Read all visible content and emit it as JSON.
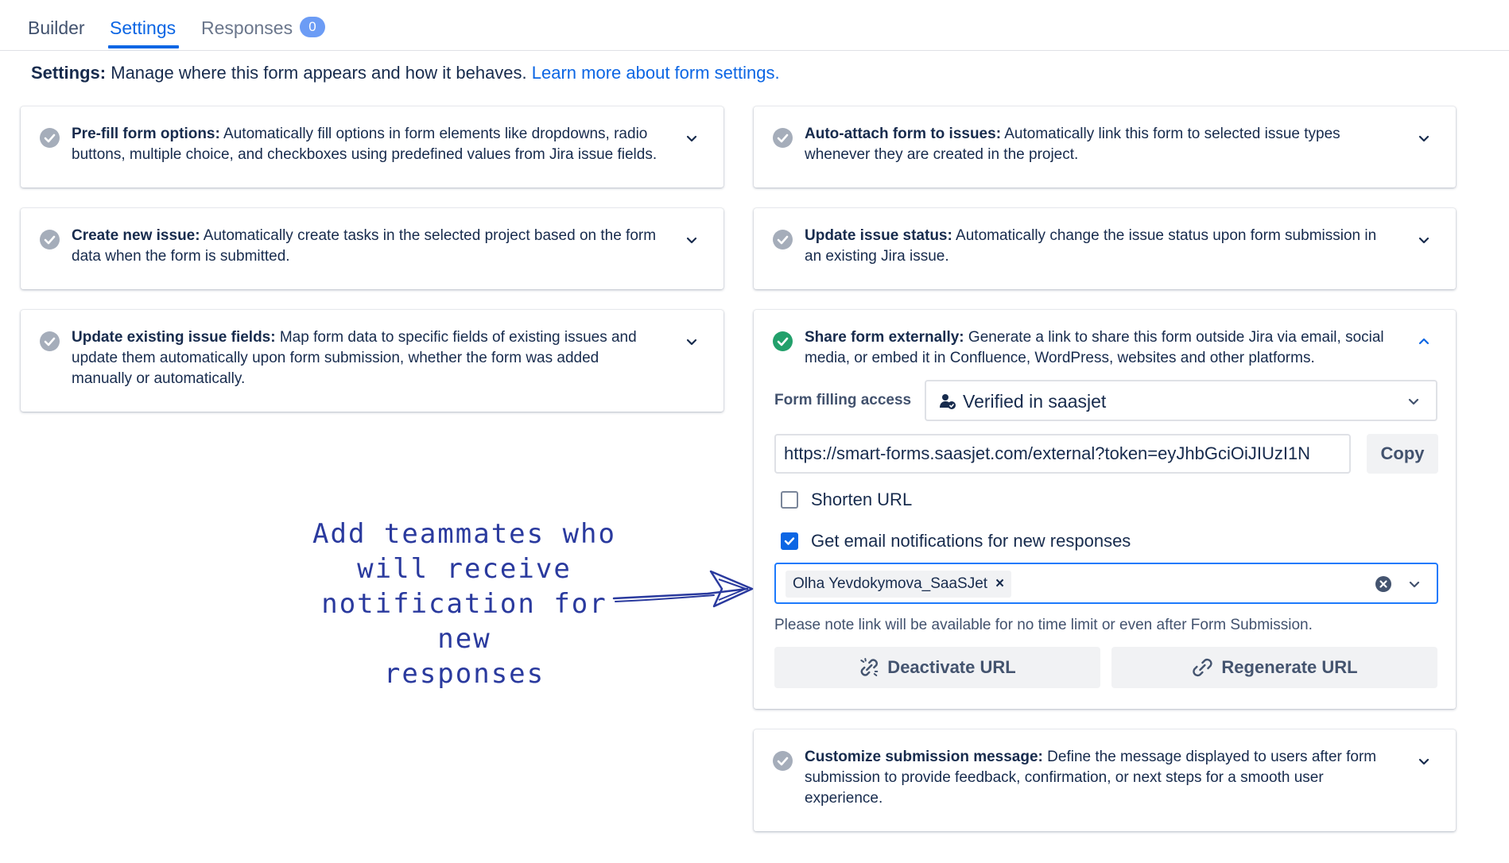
{
  "tabs": {
    "builder": "Builder",
    "settings": "Settings",
    "responses": "Responses",
    "responses_count": "0"
  },
  "intro": {
    "bold": "Settings:",
    "text": " Manage where this form appears and how it behaves. ",
    "link": "Learn more about form settings."
  },
  "cards": {
    "prefill": {
      "title": "Pre-fill form options:",
      "desc": " Automatically fill options in form elements like dropdowns, radio buttons, multiple choice, and checkboxes using predefined values from Jira issue fields."
    },
    "create_issue": {
      "title": "Create new issue:",
      "desc": " Automatically create tasks in the selected project based on the form data when the form is submitted."
    },
    "update_fields": {
      "title": "Update existing issue fields:",
      "desc": " Map form data to specific fields of existing issues and update them automatically upon form submission, whether the form was added manually or automatically."
    },
    "auto_attach": {
      "title": "Auto-attach form to issues:",
      "desc": " Automatically link this form to selected issue types whenever they are created in the project."
    },
    "update_status": {
      "title": "Update issue status:",
      "desc": " Automatically change the issue status upon form submission in an existing Jira issue."
    },
    "share": {
      "title": "Share form externally:",
      "desc": " Generate a link to share this form outside Jira via email, social media, or embed it in Confluence, WordPress, websites and other platforms.",
      "access_label": "Form filling access",
      "access_value": "Verified in saasjet",
      "url": "https://smart-forms.saasjet.com/external?token=eyJhbGciOiJIUzI1N",
      "copy_label": "Copy",
      "shorten_label": "Shorten URL",
      "shorten_checked": false,
      "notify_label": "Get email notifications for new responses",
      "notify_checked": true,
      "recipient": "Olha Yevdokymova_SaaSJet",
      "note": "Please note link will be available for no time limit or even after Form Submission.",
      "deactivate_label": "Deactivate URL",
      "regenerate_label": "Regenerate URL"
    },
    "submission_msg": {
      "title": "Customize submission message:",
      "desc": " Define the message displayed to users after form submission to provide feedback, confirmation, or next steps for a smooth user experience."
    }
  },
  "annotation": {
    "line1": "Add teammates who",
    "line2": "will receive",
    "line3": "notification for new",
    "line4": "responses"
  },
  "colors": {
    "accent": "#0c66e4",
    "check_on": "#22a06b",
    "check_off": "#a5adba",
    "annotation": "#2a3a9e"
  }
}
